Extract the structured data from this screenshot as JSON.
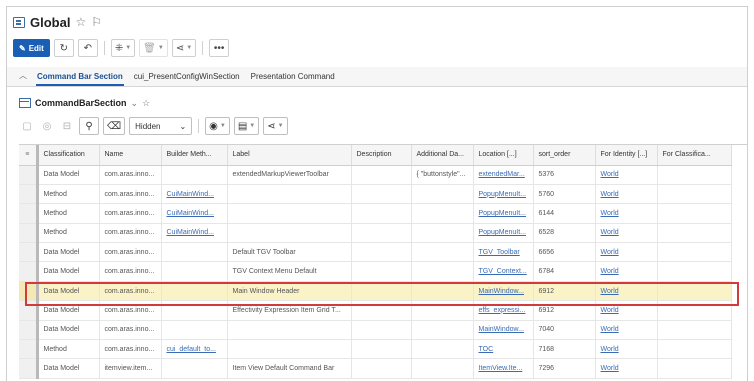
{
  "header": {
    "title": "Global"
  },
  "toolbar": {
    "edit_label": "Edit",
    "more_label": "•••"
  },
  "tabs": [
    {
      "label": "Command Bar Section"
    },
    {
      "label": "cui_PresentConfigWinSection"
    },
    {
      "label": "Presentation Command"
    }
  ],
  "section": {
    "title": "CommandBarSection"
  },
  "grid_toolbar": {
    "filter_value": "Hidden"
  },
  "table": {
    "columns": [
      "Classification",
      "Name",
      "Builder Meth...",
      "Label",
      "Description",
      "Additional Da...",
      "Location [...]",
      "sort_order",
      "For Identity [...]",
      "For Classifica..."
    ],
    "rows": [
      [
        "Data Model",
        "com.aras.inno...",
        "",
        "extendedMarkupViewerToolbar",
        "",
        "{ \"buttonstyle\"...",
        "extendedMar...",
        "5376",
        "World",
        ""
      ],
      [
        "Method",
        "com.aras.inno...",
        "CuiMainWind...",
        "",
        "",
        "",
        "PopupMenuIt...",
        "5760",
        "World",
        ""
      ],
      [
        "Method",
        "com.aras.inno...",
        "CuiMainWind...",
        "",
        "",
        "",
        "PopupMenuIt...",
        "6144",
        "World",
        ""
      ],
      [
        "Method",
        "com.aras.inno...",
        "CuiMainWind...",
        "",
        "",
        "",
        "PopupMenuIt...",
        "6528",
        "World",
        ""
      ],
      [
        "Data Model",
        "com.aras.inno...",
        "",
        "Default TGV Toolbar",
        "",
        "",
        "TGV_Toolbar",
        "6656",
        "World",
        ""
      ],
      [
        "Data Model",
        "com.aras.inno...",
        "",
        "TGV Context Menu Default",
        "",
        "",
        "TGV_Context...",
        "6784",
        "World",
        ""
      ],
      [
        "Data Model",
        "com.aras.inno...",
        "",
        "Main Window Header",
        "",
        "",
        "MainWindow...",
        "6912",
        "World",
        ""
      ],
      [
        "Data Model",
        "com.aras.inno...",
        "",
        "Effectivity Expression Item Grid T...",
        "",
        "",
        "effs_expressi...",
        "6912",
        "World",
        ""
      ],
      [
        "Data Model",
        "com.aras.inno...",
        "",
        "",
        "",
        "",
        "MainWindow...",
        "7040",
        "World",
        ""
      ],
      [
        "Method",
        "com.aras.inno...",
        "cui_default_to...",
        "",
        "",
        "",
        "TOC",
        "7168",
        "World",
        ""
      ],
      [
        "Data Model",
        "itemview.item...",
        "",
        "Item View Default Command Bar",
        "",
        "",
        "ItemView.Ite...",
        "7296",
        "World",
        ""
      ]
    ],
    "highlighted_row": 6
  }
}
